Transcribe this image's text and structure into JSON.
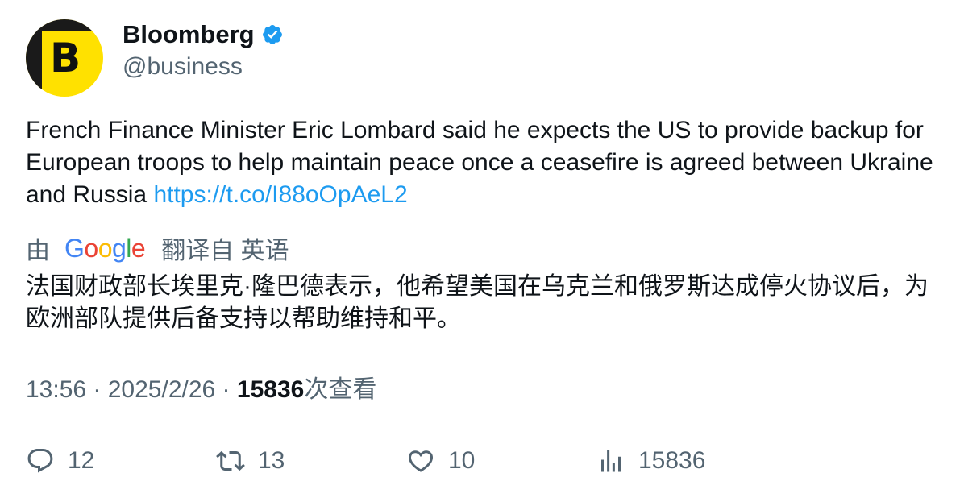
{
  "author": {
    "display_name": "Bloomberg",
    "handle": "@business",
    "avatar_letter": "B",
    "verified_icon": "verified-badge-icon",
    "avatar_color": "#ffe100"
  },
  "tweet": {
    "text": "French Finance Minister Eric Lombard said he expects the US to provide backup for European troops to help maintain peace once a ceasefire is agreed between Ukraine and Russia ",
    "link": "https://t.co/I88oOpAeL2"
  },
  "translation": {
    "prefix": "由",
    "google": [
      "G",
      "o",
      "o",
      "g",
      "l",
      "e"
    ],
    "suffix": "翻译自 英语",
    "text": "法国财政部长埃里克·隆巴德表示，他希望美国在乌克兰和俄罗斯达成停火协议后，为欧洲部队提供后备支持以帮助维持和平。"
  },
  "meta": {
    "time": "13:56",
    "separator": " · ",
    "date": "2025/2/26",
    "views": "15836",
    "views_label": "次查看"
  },
  "actions": {
    "reply": {
      "icon": "reply-icon",
      "count": "12"
    },
    "retweet": {
      "icon": "retweet-icon",
      "count": "13"
    },
    "like": {
      "icon": "heart-icon",
      "count": "10"
    },
    "views": {
      "icon": "analytics-icon",
      "count": "15836"
    }
  },
  "colors": {
    "link": "#1d9bf0",
    "secondary_text": "#536471",
    "primary_text": "#0f1419"
  }
}
